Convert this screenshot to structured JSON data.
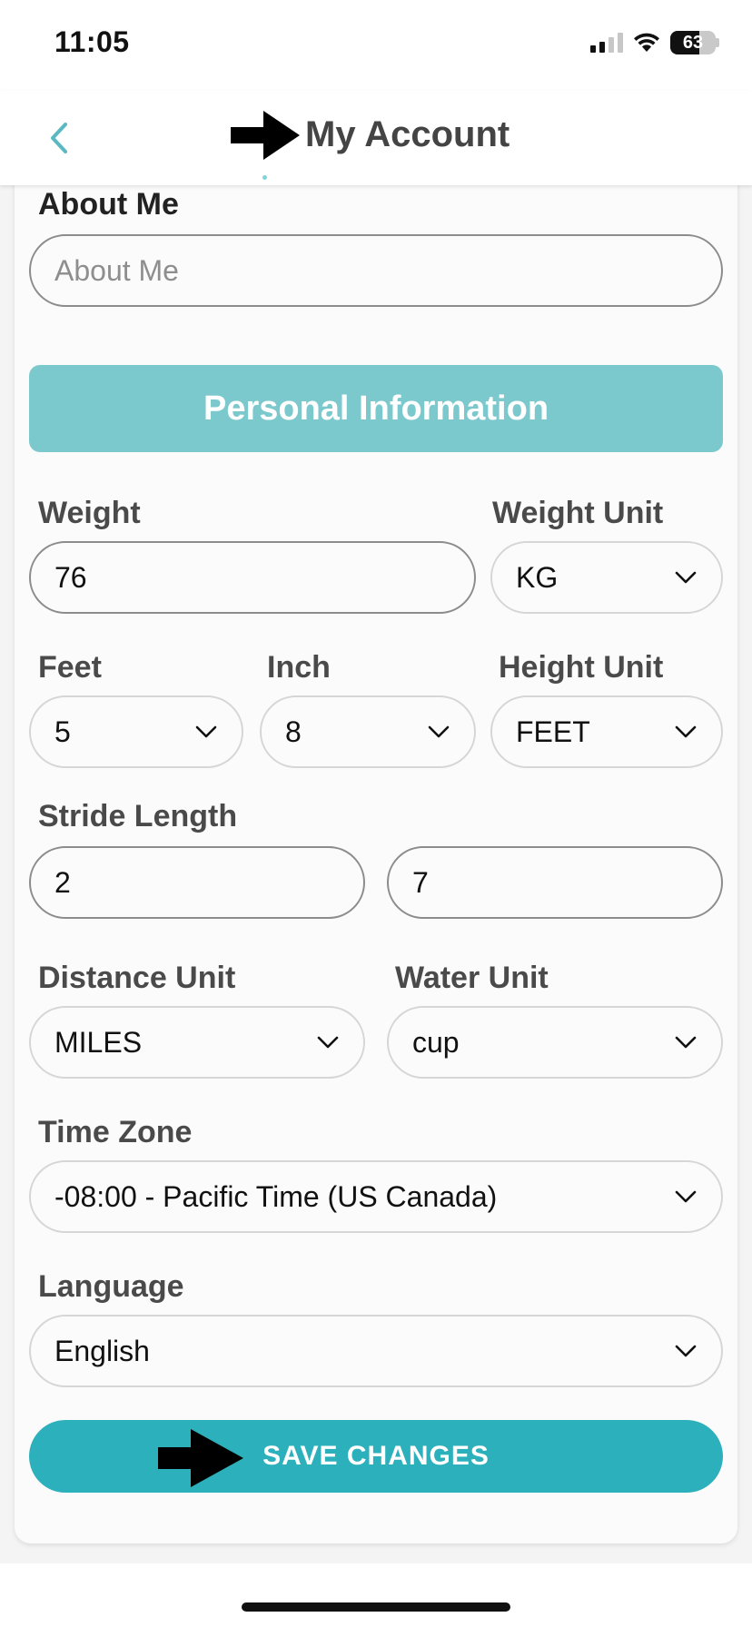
{
  "status_bar": {
    "time": "11:05",
    "battery": "63",
    "battery_level": 0.63
  },
  "header": {
    "title": "My Account",
    "back_icon": "chevron-left-icon"
  },
  "form": {
    "about_me": {
      "label": "About Me",
      "placeholder": "About Me",
      "value": ""
    },
    "section_title": "Personal Information",
    "weight": {
      "label": "Weight",
      "value": "76"
    },
    "weight_unit": {
      "label": "Weight Unit",
      "value": "KG"
    },
    "feet": {
      "label": "Feet",
      "value": "5"
    },
    "inch": {
      "label": "Inch",
      "value": "8"
    },
    "height_unit": {
      "label": "Height Unit",
      "value": "FEET"
    },
    "stride_length": {
      "label": "Stride Length",
      "value_1": "2",
      "value_2": "7"
    },
    "distance_unit": {
      "label": "Distance Unit",
      "value": "MILES"
    },
    "water_unit": {
      "label": "Water Unit",
      "value": "cup"
    },
    "time_zone": {
      "label": "Time Zone",
      "value": "-08:00 - Pacific Time (US Canada)"
    },
    "language": {
      "label": "Language",
      "value": "English"
    },
    "save_button": "SAVE CHANGES"
  },
  "colors": {
    "accent": "#2cb0bb",
    "banner": "#7cc9cd",
    "back_icon": "#5ab8c0"
  }
}
